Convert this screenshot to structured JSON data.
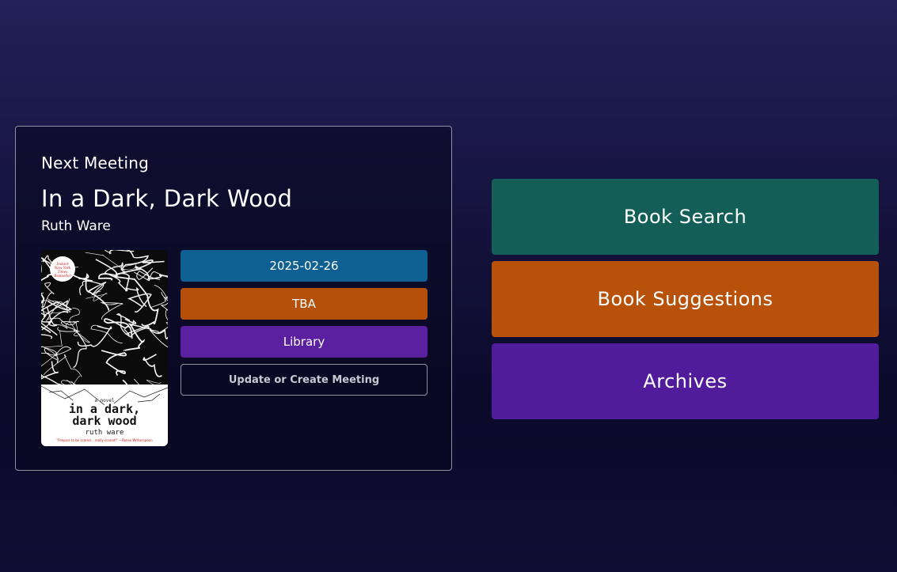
{
  "meeting": {
    "heading": "Next Meeting",
    "title": "In a Dark, Dark Wood",
    "author": "Ruth Ware",
    "date": "2025-02-26",
    "time": "TBA",
    "location": "Library",
    "update_label": "Update or Create Meeting",
    "cover": {
      "badge_text": "Instant New York Times Bestseller",
      "subtitle": "a novel",
      "title_line1": "in a dark,",
      "title_line2": "dark wood",
      "author": "ruth ware",
      "quote": "\"Prepare to be scared... really scared!\" —Reese Witherspoon"
    }
  },
  "nav": {
    "book_search": "Book Search",
    "book_suggestions": "Book Suggestions",
    "archives": "Archives"
  },
  "colors": {
    "date": "#0e5f92",
    "time": "#b5500a",
    "location": "#5a20a0",
    "book_search": "#135f57",
    "book_suggestions": "#b8520b",
    "archives": "#511c9c"
  }
}
